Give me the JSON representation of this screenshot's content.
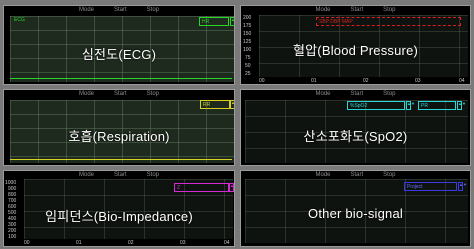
{
  "tabs": [
    "Mode",
    "Start",
    "Stop"
  ],
  "panels": {
    "ecg": {
      "title": "심전도(ECG)",
      "legend": "HR",
      "trace_label": "ECG",
      "accent": "#2ad62a"
    },
    "bp": {
      "title": "혈압(Blood Pressure)",
      "legend": "SBP  DBP  MAP",
      "accent": "#d82020",
      "y_ticks": [
        "200",
        "175",
        "150",
        "125",
        "100",
        "75",
        "50",
        "25"
      ],
      "x_ticks": [
        "00",
        "01",
        "02",
        "03",
        "04"
      ]
    },
    "resp": {
      "title": "호흡(Respiration)",
      "legend": "RR",
      "accent": "#d8d020"
    },
    "spo2": {
      "title": "산소포화도(SpO2)",
      "legend_a": "%SpO2",
      "legend_b": "PR",
      "accent": "#2ad6d6"
    },
    "bioimp": {
      "title": "임피던스(Bio-Impedance)",
      "legend": "Z",
      "accent": "#d42ad4",
      "y_ticks": [
        "1000",
        "900",
        "800",
        "700",
        "600",
        "500",
        "400",
        "300",
        "200",
        "100"
      ],
      "x_ticks": [
        "00",
        "01",
        "02",
        "03",
        "04"
      ]
    },
    "other": {
      "title": "Other bio-signal",
      "legend": "Project",
      "accent": "#3a3ae0"
    }
  }
}
